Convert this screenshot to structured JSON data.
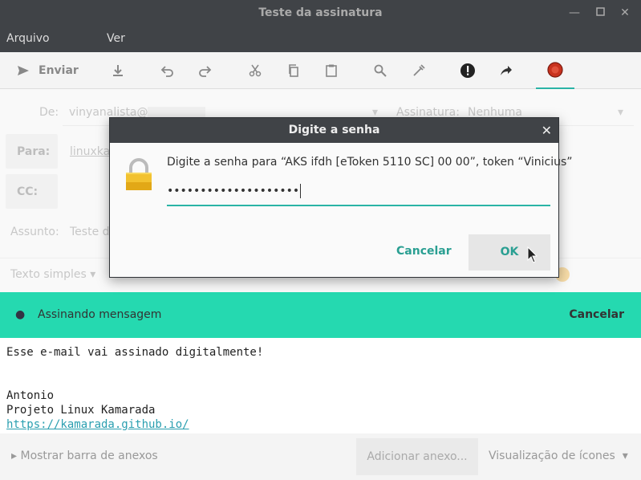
{
  "window": {
    "title": "Teste da assinatura"
  },
  "menu": {
    "file": "Arquivo",
    "view": "Ver"
  },
  "toolbar": {
    "send_label": "Enviar"
  },
  "headers": {
    "from_label": "De:",
    "from_value": "vinyanalista@",
    "signature_label": "Assinatura:",
    "signature_value": "Nenhuma",
    "to_label": "Para:",
    "to_value": "linuxka",
    "cc_label": "CC:",
    "subject_label": "Assunto:",
    "subject_value": "Teste d"
  },
  "format": {
    "mode": "Texto simples"
  },
  "signing": {
    "message": "Assinando mensagem",
    "cancel": "Cancelar"
  },
  "body": {
    "line1": "Esse e-mail vai assinado digitalmente!",
    "line2": "Antonio",
    "line3": "Projeto Linux Kamarada",
    "link": "https://kamarada.github.io/"
  },
  "bottom": {
    "attach_toggle": "Mostrar barra de anexos",
    "add_attachment": "Adicionar anexo...",
    "view_mode": "Visualização de ícones"
  },
  "dialog": {
    "title": "Digite a senha",
    "prompt": "Digite a senha para “AKS ifdh [eToken 5110 SC] 00 00”, token “Vinicius”",
    "password": "••••••••••••••••••••",
    "cancel": "Cancelar",
    "ok": "OK"
  },
  "colors": {
    "accent": "#2ab4a6",
    "signbar": "#25d9b0",
    "titlebar": "#404347"
  }
}
